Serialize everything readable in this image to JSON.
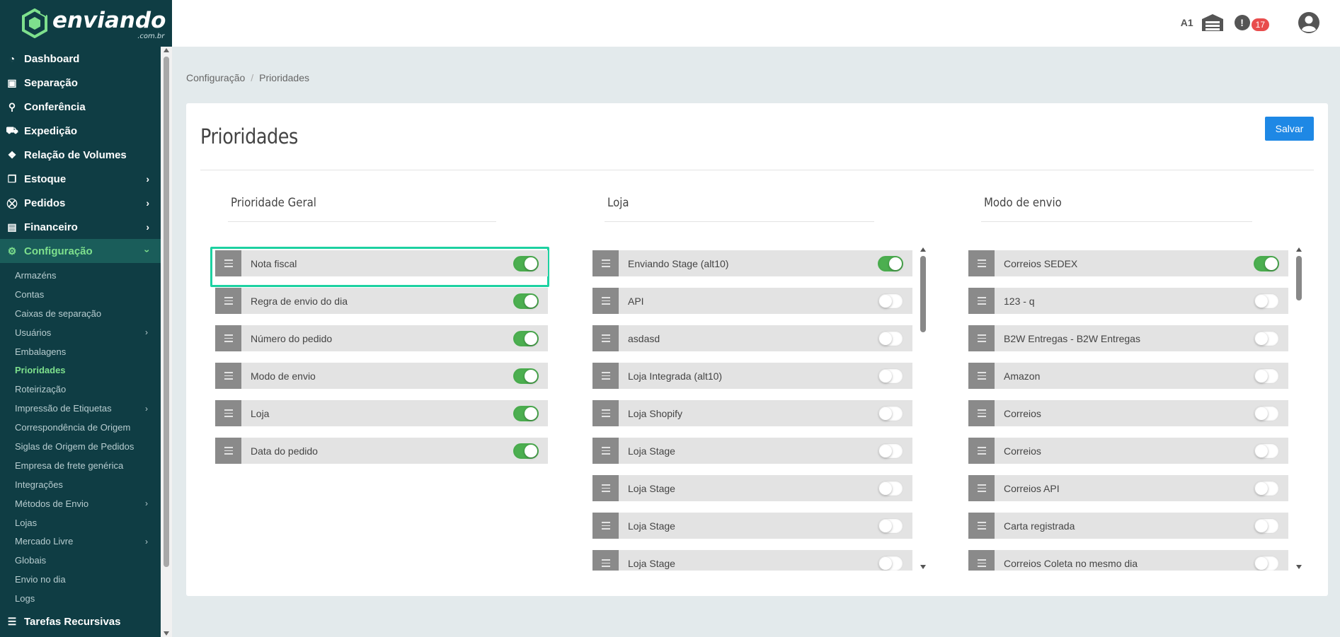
{
  "brand": {
    "name": "enviando",
    "domain": ".com.br",
    "color": "#7ee08d"
  },
  "sidebar": {
    "items": [
      {
        "label": "Dashboard",
        "icon": "dashboard-icon",
        "glyph": "◔"
      },
      {
        "label": "Separação",
        "icon": "briefcase-icon",
        "glyph": "▣"
      },
      {
        "label": "Conferência",
        "icon": "search-icon",
        "glyph": "⚲"
      },
      {
        "label": "Expedição",
        "icon": "truck-icon",
        "glyph": "⛟"
      },
      {
        "label": "Relação de Volumes",
        "icon": "boxes-icon",
        "glyph": "❖"
      },
      {
        "label": "Estoque",
        "icon": "dropbox-icon",
        "glyph": "❒",
        "chevron": "›"
      },
      {
        "label": "Pedidos",
        "icon": "cart-icon",
        "glyph": "⛒",
        "chevron": "›"
      },
      {
        "label": "Financeiro",
        "icon": "money-icon",
        "glyph": "▤",
        "chevron": "›"
      },
      {
        "label": "Configuração",
        "icon": "gear-icon",
        "glyph": "⚙",
        "chevron": "›"
      }
    ],
    "sub_items": [
      {
        "label": "Armazéns"
      },
      {
        "label": "Contas"
      },
      {
        "label": "Caixas de separação"
      },
      {
        "label": "Usuários",
        "chevron": "›"
      },
      {
        "label": "Embalagens"
      },
      {
        "label": "Prioridades"
      },
      {
        "label": "Roteirização"
      },
      {
        "label": "Impressão de Etiquetas",
        "chevron": "›"
      },
      {
        "label": "Correspondência de Origem"
      },
      {
        "label": "Siglas de Origem de Pedidos"
      },
      {
        "label": "Empresa de frete genérica"
      },
      {
        "label": "Integrações"
      },
      {
        "label": "Métodos de Envio",
        "chevron": "›"
      },
      {
        "label": "Lojas"
      },
      {
        "label": "Mercado Livre",
        "chevron": "›"
      },
      {
        "label": "Globais"
      },
      {
        "label": "Envio no dia"
      },
      {
        "label": "Logs"
      }
    ],
    "bottom_item": {
      "label": "Tarefas Recursivas",
      "icon": "tasks-icon",
      "glyph": "☰"
    }
  },
  "topbar": {
    "warehouse_code": "A1",
    "notification_count": "17",
    "alert_glyph": "!"
  },
  "breadcrumb": {
    "parent": "Configuração",
    "sep": "/",
    "current": "Prioridades"
  },
  "page": {
    "title": "Prioridades",
    "save_label": "Salvar"
  },
  "columns": [
    {
      "title": "Prioridade Geral",
      "rows": [
        {
          "label": "Nota fiscal",
          "on": true
        },
        {
          "label": "Regra de envio do dia",
          "on": true
        },
        {
          "label": "Número do pedido",
          "on": true
        },
        {
          "label": "Modo de envio",
          "on": true
        },
        {
          "label": "Loja",
          "on": true
        },
        {
          "label": "Data do pedido",
          "on": true
        }
      ]
    },
    {
      "title": "Loja",
      "rows": [
        {
          "label": "Enviando Stage (alt10)",
          "on": true
        },
        {
          "label": "API",
          "on": false
        },
        {
          "label": "asdasd",
          "on": false
        },
        {
          "label": "Loja Integrada (alt10)",
          "on": false
        },
        {
          "label": "Loja Shopify",
          "on": false
        },
        {
          "label": "Loja Stage",
          "on": false
        },
        {
          "label": "Loja Stage",
          "on": false
        },
        {
          "label": "Loja Stage",
          "on": false
        },
        {
          "label": "Loja Stage",
          "on": false
        }
      ]
    },
    {
      "title": "Modo de envio",
      "rows": [
        {
          "label": "Correios SEDEX",
          "on": true
        },
        {
          "label": "123 - q",
          "on": false
        },
        {
          "label": "B2W Entregas - B2W Entregas",
          "on": false
        },
        {
          "label": "Amazon",
          "on": false
        },
        {
          "label": "Correios",
          "on": false
        },
        {
          "label": "Correios",
          "on": false
        },
        {
          "label": "Correios API",
          "on": false
        },
        {
          "label": "Carta registrada",
          "on": false
        },
        {
          "label": "Correios Coleta no mesmo dia",
          "on": false
        }
      ]
    }
  ]
}
